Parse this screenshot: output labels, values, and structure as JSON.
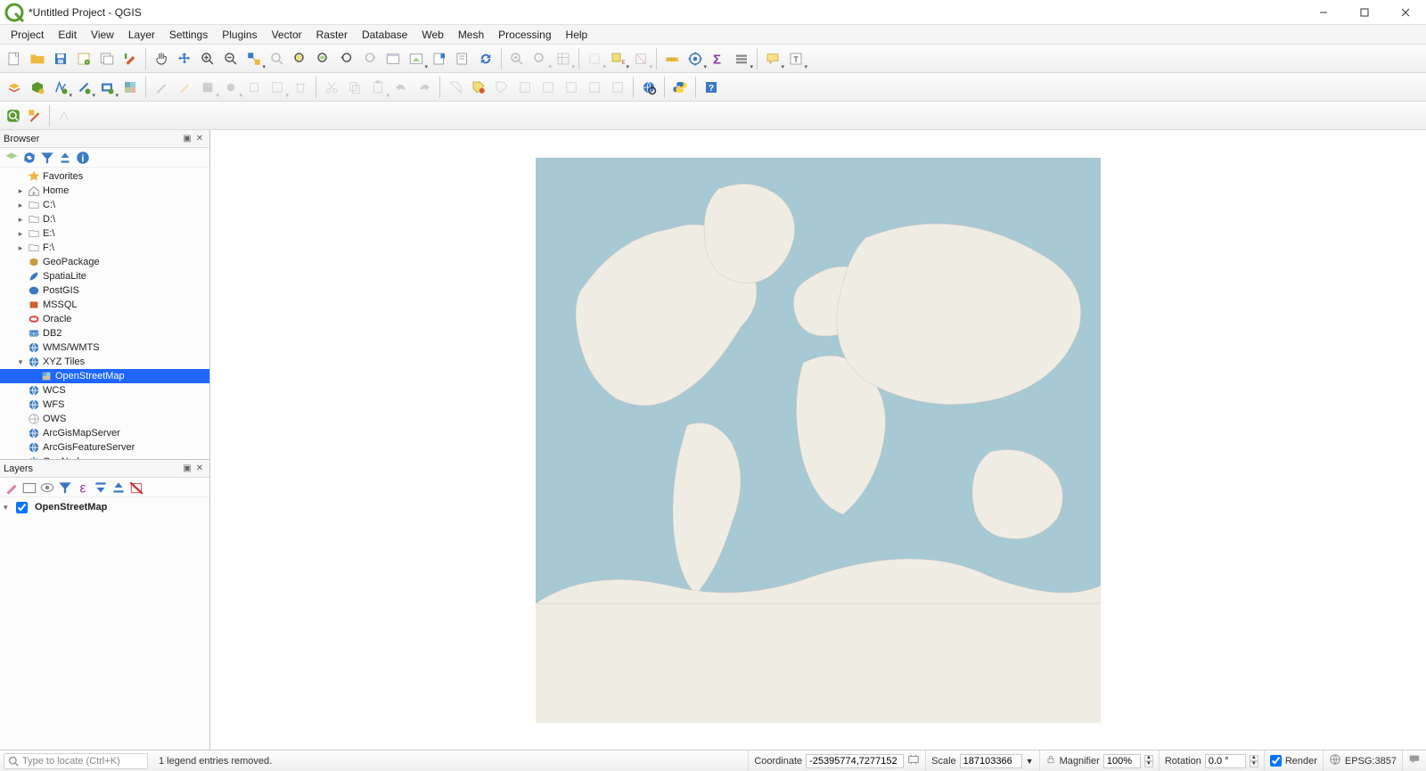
{
  "window": {
    "title": "*Untitled Project - QGIS"
  },
  "menu": [
    "Project",
    "Edit",
    "View",
    "Layer",
    "Settings",
    "Plugins",
    "Vector",
    "Raster",
    "Database",
    "Web",
    "Mesh",
    "Processing",
    "Help"
  ],
  "panels": {
    "browser": {
      "title": "Browser"
    },
    "layers": {
      "title": "Layers"
    }
  },
  "browser_tree": [
    {
      "label": "Favorites",
      "icon": "star",
      "indent": 1
    },
    {
      "label": "Home",
      "icon": "home",
      "indent": 1,
      "exp": "▸"
    },
    {
      "label": "C:\\",
      "icon": "folder-g",
      "indent": 1,
      "exp": "▸"
    },
    {
      "label": "D:\\",
      "icon": "folder-g",
      "indent": 1,
      "exp": "▸"
    },
    {
      "label": "E:\\",
      "icon": "folder-g",
      "indent": 1,
      "exp": "▸"
    },
    {
      "label": "F:\\",
      "icon": "folder-g",
      "indent": 1,
      "exp": "▸"
    },
    {
      "label": "GeoPackage",
      "icon": "geopkg",
      "indent": 1
    },
    {
      "label": "SpatiaLite",
      "icon": "feather",
      "indent": 1
    },
    {
      "label": "PostGIS",
      "icon": "elephant",
      "indent": 1
    },
    {
      "label": "MSSQL",
      "icon": "mssql",
      "indent": 1
    },
    {
      "label": "Oracle",
      "icon": "oracle",
      "indent": 1
    },
    {
      "label": "DB2",
      "icon": "db2",
      "indent": 1
    },
    {
      "label": "WMS/WMTS",
      "icon": "globe",
      "indent": 1
    },
    {
      "label": "XYZ Tiles",
      "icon": "globe",
      "indent": 1,
      "exp": "▾"
    },
    {
      "label": "OpenStreetMap",
      "icon": "osm",
      "indent": 2,
      "selected": true
    },
    {
      "label": "WCS",
      "icon": "globe",
      "indent": 1
    },
    {
      "label": "WFS",
      "icon": "globe",
      "indent": 1
    },
    {
      "label": "OWS",
      "icon": "globe-g",
      "indent": 1
    },
    {
      "label": "ArcGisMapServer",
      "icon": "globe",
      "indent": 1
    },
    {
      "label": "ArcGisFeatureServer",
      "icon": "globe",
      "indent": 1
    },
    {
      "label": "GeoNode",
      "icon": "snow",
      "indent": 1
    }
  ],
  "layers": [
    {
      "label": "OpenStreetMap",
      "checked": true
    }
  ],
  "status": {
    "locate_placeholder": "Type to locate (Ctrl+K)",
    "message": "1 legend entries removed.",
    "coord_label": "Coordinate",
    "coord_value": "-25395774,7277152",
    "scale_label": "Scale",
    "scale_value": "187103366",
    "mag_label": "Magnifier",
    "mag_value": "100%",
    "rot_label": "Rotation",
    "rot_value": "0.0 °",
    "render_label": "Render",
    "epsg": "EPSG:3857"
  },
  "icons": {
    "new": "📄",
    "open": "📂",
    "save": "💾"
  }
}
